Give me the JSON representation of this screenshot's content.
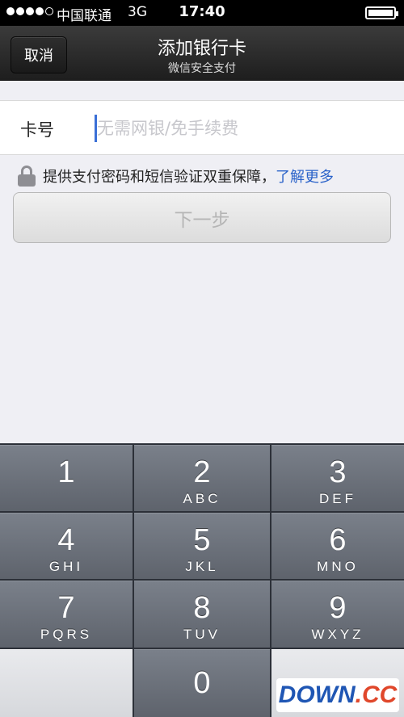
{
  "status_bar": {
    "carrier": "中国联通",
    "network": "3G",
    "time": "17:40"
  },
  "nav": {
    "cancel_label": "取消",
    "title": "添加银行卡",
    "subtitle": "微信安全支付"
  },
  "card": {
    "label": "卡号",
    "value": "",
    "placeholder": "无需网银/免手续费"
  },
  "notice": {
    "text": "提供支付密码和短信验证双重保障，",
    "link": "了解更多"
  },
  "next_button": "下一步",
  "keypad": {
    "keys": [
      {
        "num": "1",
        "letters": ""
      },
      {
        "num": "2",
        "letters": "ABC"
      },
      {
        "num": "3",
        "letters": "DEF"
      },
      {
        "num": "4",
        "letters": "GHI"
      },
      {
        "num": "5",
        "letters": "JKL"
      },
      {
        "num": "6",
        "letters": "MNO"
      },
      {
        "num": "7",
        "letters": "PQRS"
      },
      {
        "num": "8",
        "letters": "TUV"
      },
      {
        "num": "9",
        "letters": "WXYZ"
      },
      {
        "num": "0",
        "letters": ""
      }
    ]
  },
  "watermark": {
    "part1": "DOWN",
    "part2": ".CC"
  },
  "colors": {
    "link": "#2a62c9",
    "cursor": "#3a6fd6",
    "nav_bg": "#2a2a2a"
  }
}
